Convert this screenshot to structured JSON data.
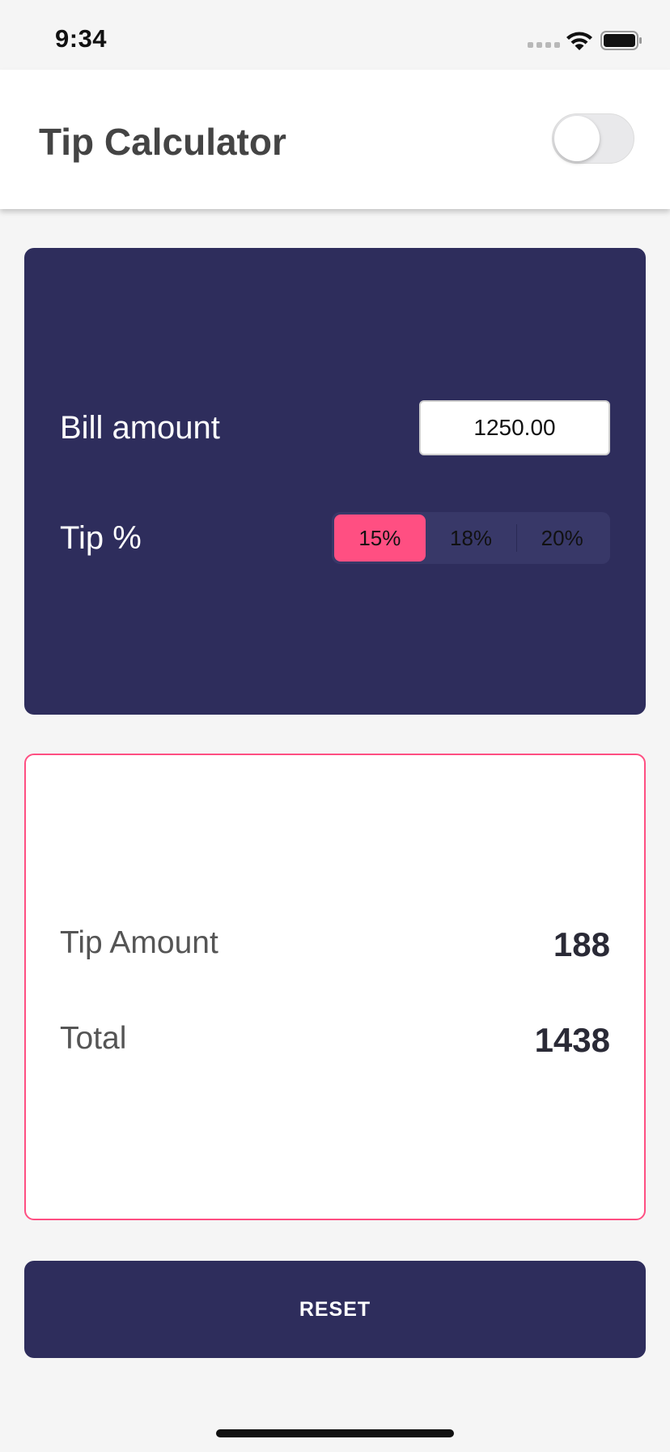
{
  "status_bar": {
    "time": "9:34"
  },
  "header": {
    "title": "Tip Calculator",
    "dark_mode_toggle_on": false
  },
  "input_card": {
    "bill_label": "Bill amount",
    "bill_value": "1250.00",
    "tip_label": "Tip %",
    "tip_options": [
      "15%",
      "18%",
      "20%"
    ],
    "selected_tip_index": 0
  },
  "results": {
    "tip_amount_label": "Tip Amount",
    "tip_amount_value": "188",
    "total_label": "Total",
    "total_value": "1438"
  },
  "reset_button": {
    "label": "RESET"
  },
  "colors": {
    "card_background": "#2e2d5c",
    "accent": "#ff4f82",
    "page_background": "#f5f5f5"
  },
  "icons": {
    "status": [
      "cellular-signal-icon",
      "wifi-icon",
      "battery-icon"
    ]
  }
}
